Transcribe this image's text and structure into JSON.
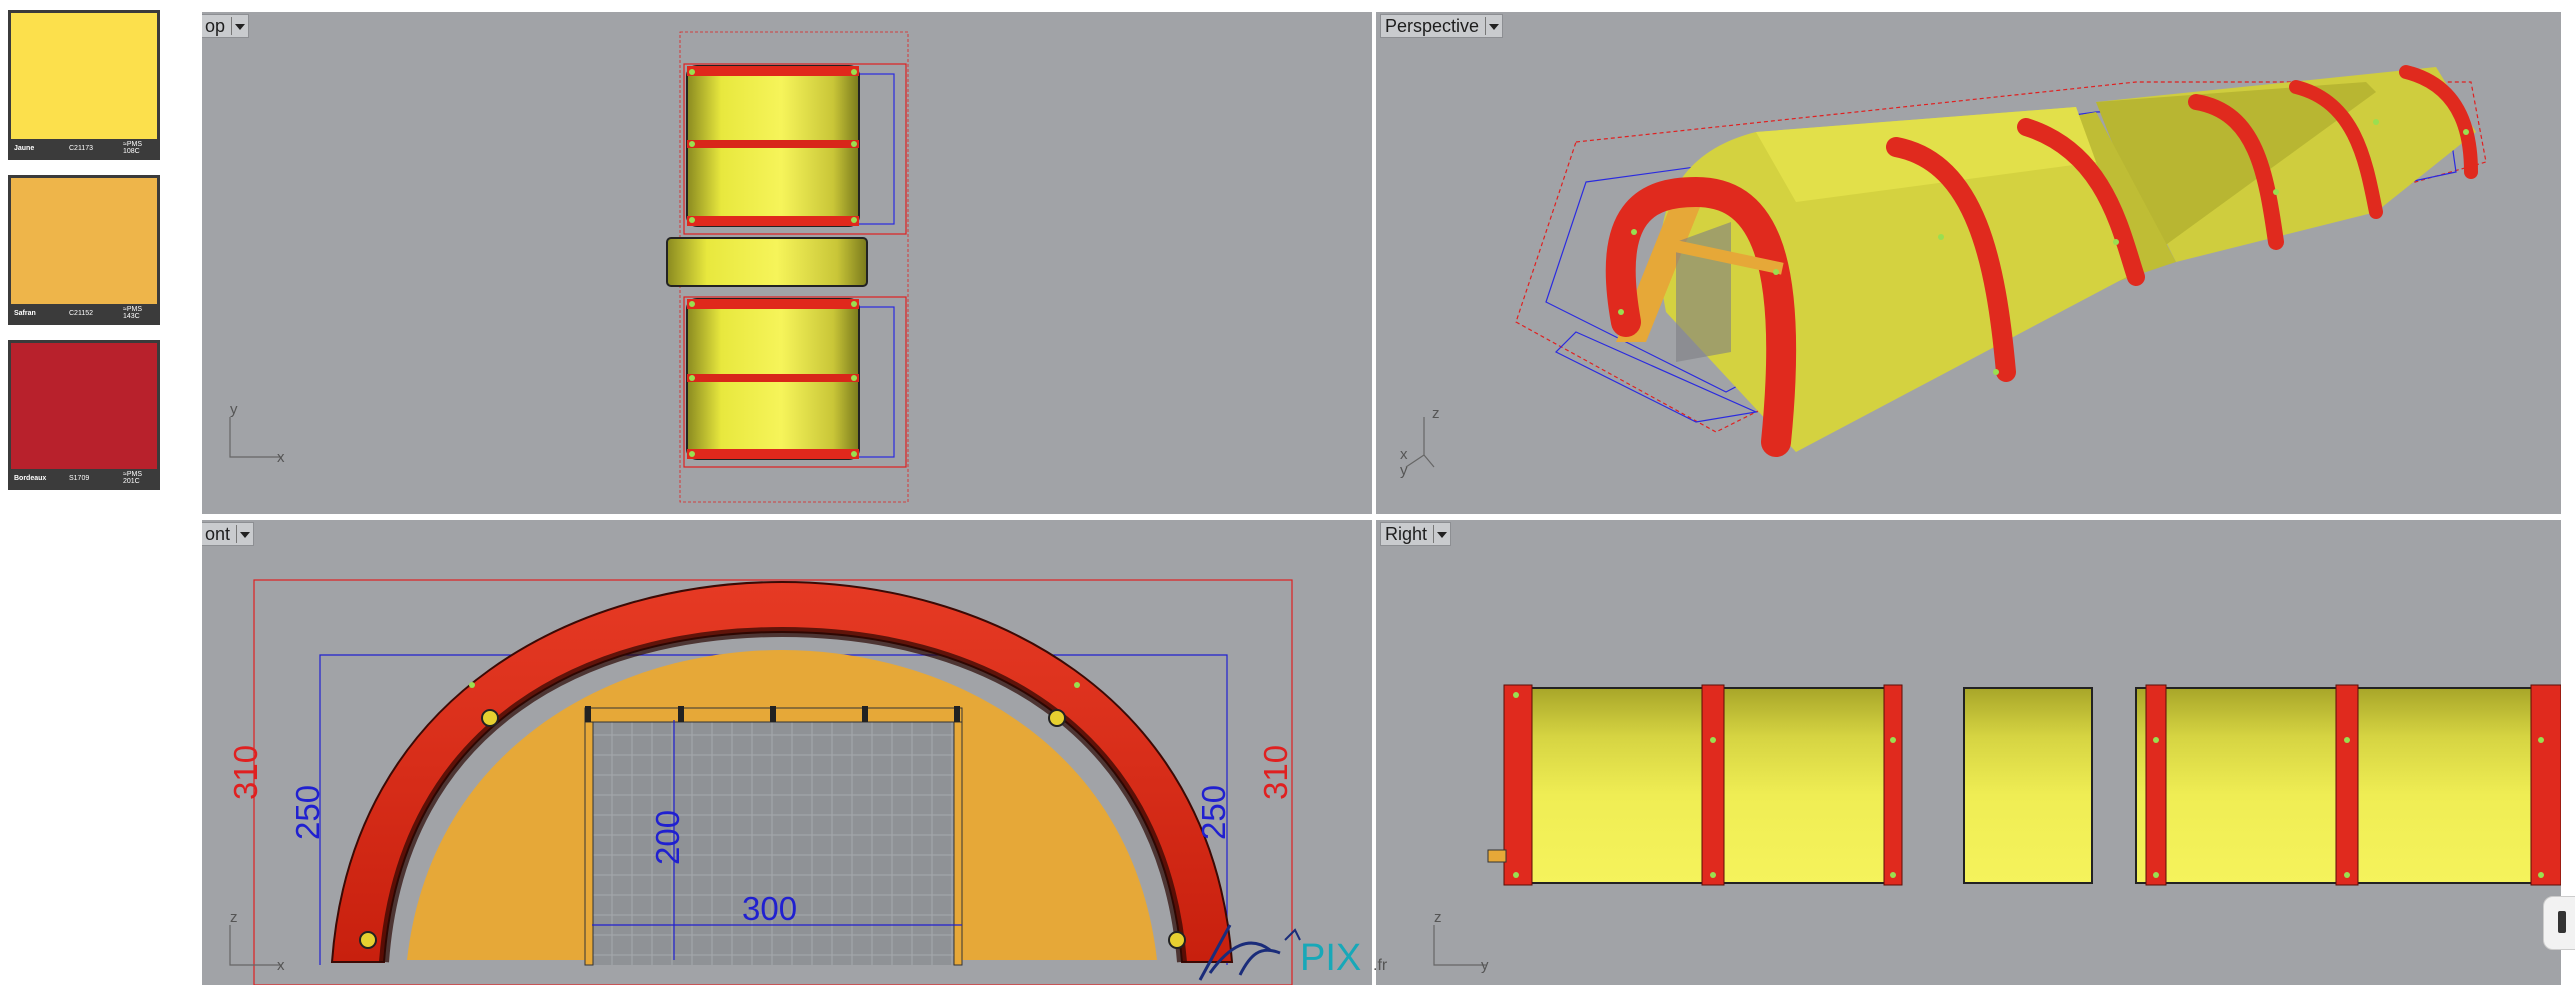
{
  "swatches": [
    {
      "name": "Jaune",
      "code": "C21173",
      "pms": "≈PMS 108C",
      "color": "#fce04c"
    },
    {
      "name": "Safran",
      "code": "C21152",
      "pms": "≈PMS 143C",
      "color": "#eeb54a"
    },
    {
      "name": "Bordeaux",
      "code": "S1709",
      "pms": "≈PMS 201C",
      "color": "#b8212c"
    }
  ],
  "viewports": {
    "top": {
      "title": "op",
      "axis_y": "y",
      "axis_x": "x"
    },
    "perspective": {
      "title": "Perspective",
      "axis_z": "z",
      "axis_x": "x",
      "axis_y": "y"
    },
    "front": {
      "title": "ont",
      "axis_z": "z",
      "axis_x": "x",
      "dim_height_outer_left": "310",
      "dim_height_inner_left": "250",
      "dim_door_height": "200",
      "dim_door_width": "300",
      "dim_height_inner_right": "250",
      "dim_height_outer_right": "310"
    },
    "right": {
      "title": "Right",
      "axis_z": "z",
      "axis_y": "y"
    }
  },
  "watermark": {
    "logo_text": "PIX",
    "suffix": ".fr"
  },
  "colors": {
    "viewport_bg": "#a1a3a7",
    "tent_yellow": "#eeee50",
    "arch_red": "#e02a1e",
    "dim_red": "#e02020",
    "dim_blue": "#2020d0"
  }
}
